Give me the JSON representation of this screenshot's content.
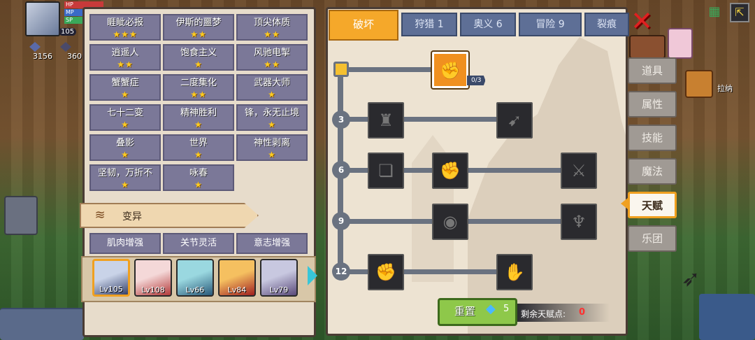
{
  "hud": {
    "level": "105",
    "bars": [
      "HP",
      "MP",
      "SP"
    ],
    "currency_a": "3156",
    "currency_b": "360",
    "npc_name": "拉纳"
  },
  "talents": [
    {
      "name": "睚眦必报",
      "stars": 3
    },
    {
      "name": "伊斯的噩梦",
      "stars": 2
    },
    {
      "name": "顶尖体质",
      "stars": 2
    },
    {
      "name": "逍遥人",
      "stars": 2
    },
    {
      "name": "饱食主义",
      "stars": 1
    },
    {
      "name": "风驰电掣",
      "stars": 2
    },
    {
      "name": "蟹蟹症",
      "stars": 1
    },
    {
      "name": "二度集化",
      "stars": 2
    },
    {
      "name": "武器大师",
      "stars": 1
    },
    {
      "name": "七十二变",
      "stars": 1
    },
    {
      "name": "精神胜利",
      "stars": 1
    },
    {
      "name": "锋，永无止境",
      "stars": 1
    },
    {
      "name": "叠影",
      "stars": 1
    },
    {
      "name": "世界",
      "stars": 1
    },
    {
      "name": "神性剥离",
      "stars": 1
    },
    {
      "name": "坚韧，万折不",
      "stars": 1
    },
    {
      "name": "咏春",
      "stars": 1
    }
  ],
  "mutation": {
    "title": "变异",
    "items": [
      "肌肉增强",
      "关节灵活",
      "意志增强"
    ]
  },
  "characters": [
    {
      "level": "Lv105",
      "colors": [
        "#c9d3e8",
        "#34406a"
      ],
      "selected": true
    },
    {
      "level": "Lv108",
      "colors": [
        "#f4d8d8",
        "#b23a3a"
      ],
      "selected": false
    },
    {
      "level": "Lv66",
      "colors": [
        "#9ad8e0",
        "#2a5a7a"
      ],
      "selected": false
    },
    {
      "level": "Lv84",
      "colors": [
        "#f5c060",
        "#a02020"
      ],
      "selected": false
    },
    {
      "level": "Lv79",
      "colors": [
        "#c8c8e0",
        "#5a4a7a"
      ],
      "selected": false
    }
  ],
  "tabs": [
    {
      "label": "破坏",
      "active": true
    },
    {
      "label": "狩猎 1",
      "active": false
    },
    {
      "label": "奥义 6",
      "active": false
    },
    {
      "label": "冒险 9",
      "active": false
    },
    {
      "label": "裂痕",
      "active": false
    }
  ],
  "tree": {
    "root_count": "0/3",
    "tiers": [
      "3",
      "6",
      "9",
      "12"
    ]
  },
  "reset": {
    "label": "重置",
    "cost": "5",
    "remaining_label": "剩余天赋点:",
    "remaining_value": "0"
  },
  "side_menu": [
    {
      "label": "道具",
      "active": false
    },
    {
      "label": "属性",
      "active": false
    },
    {
      "label": "技能",
      "active": false
    },
    {
      "label": "魔法",
      "active": false
    },
    {
      "label": "天赋",
      "active": true
    },
    {
      "label": "乐团",
      "active": false
    }
  ],
  "colors": {
    "accent": "#f5a82a",
    "tab_inactive": "#5e6f96",
    "talent_cell": "#7b7898",
    "reset_green": "#8ec84a",
    "star": "#ffcc22",
    "remaining_red": "#ff3030"
  }
}
